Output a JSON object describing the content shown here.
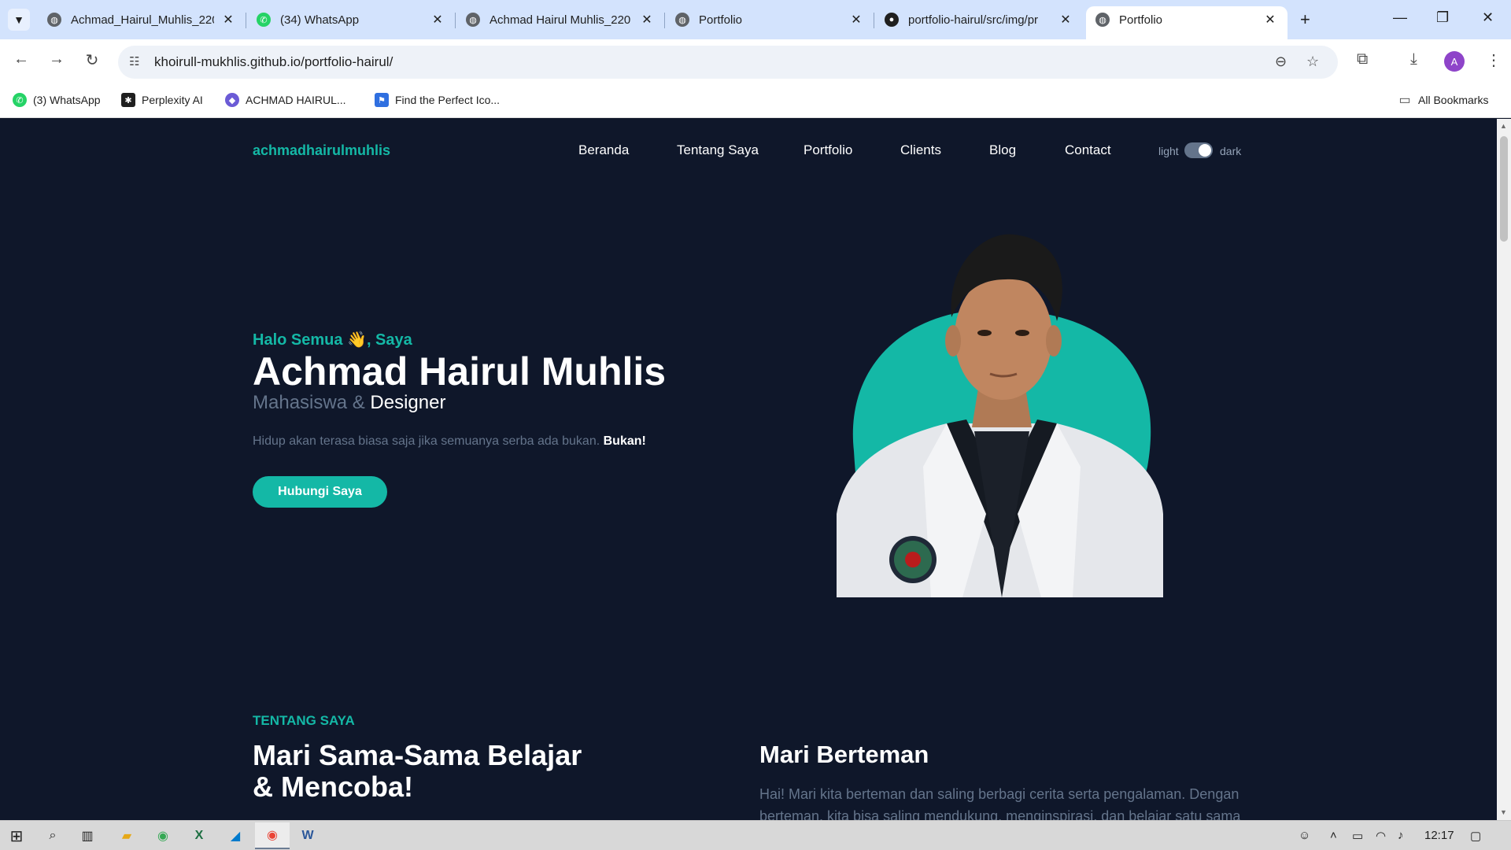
{
  "browser": {
    "tabs": [
      {
        "label": "Achmad_Hairul_Muhlis_220",
        "icon": "globe-icon"
      },
      {
        "label": "(34) WhatsApp",
        "icon": "whatsapp-icon"
      },
      {
        "label": "Achmad Hairul Muhlis_220",
        "icon": "globe-icon"
      },
      {
        "label": "Portfolio",
        "icon": "globe-icon"
      },
      {
        "label": "portfolio-hairul/src/img/pr",
        "icon": "github-icon"
      },
      {
        "label": "Portfolio",
        "icon": "globe-icon",
        "active": true
      }
    ],
    "new_tab": "+",
    "url": "khoirull-mukhlis.github.io/portfolio-hairul/",
    "profile_initial": "A",
    "bookmarks": [
      {
        "label": "(3) WhatsApp",
        "icon": "whatsapp-icon"
      },
      {
        "label": "Perplexity AI",
        "icon": "perplexity-icon"
      },
      {
        "label": "ACHMAD HAIRUL...",
        "icon": "site-icon"
      },
      {
        "label": "Find the Perfect Ico...",
        "icon": "flag-icon"
      }
    ],
    "all_bookmarks": "All Bookmarks"
  },
  "site": {
    "logo": "achmadhairulmuhlis",
    "nav": [
      "Beranda",
      "Tentang Saya",
      "Portfolio",
      "Clients",
      "Blog",
      "Contact"
    ],
    "theme_light": "light",
    "theme_dark": "dark",
    "theme_dark_on": true,
    "accent": "#14b8a6",
    "background": "#0f172a"
  },
  "hero": {
    "greeting": "Halo Semua 👋, Saya",
    "name": "Achmad Hairul Muhlis",
    "role_prefix": "Mahasiswa & ",
    "role_strong": "Designer",
    "quote": "Hidup akan terasa biasa saja jika semuanya serba ada bukan. ",
    "quote_strong": "Bukan!",
    "cta": "Hubungi Saya"
  },
  "about": {
    "label": "TENTANG SAYA",
    "title": "Mari Sama-Sama Belajar & Mencoba!",
    "friend_title": "Mari Berteman",
    "friend_text": "Hai! Mari kita berteman dan saling berbagi cerita serta pengalaman. Dengan berteman, kita bisa saling mendukung, menginspirasi, dan belajar satu sama"
  },
  "taskbar": {
    "time": "12:17"
  }
}
